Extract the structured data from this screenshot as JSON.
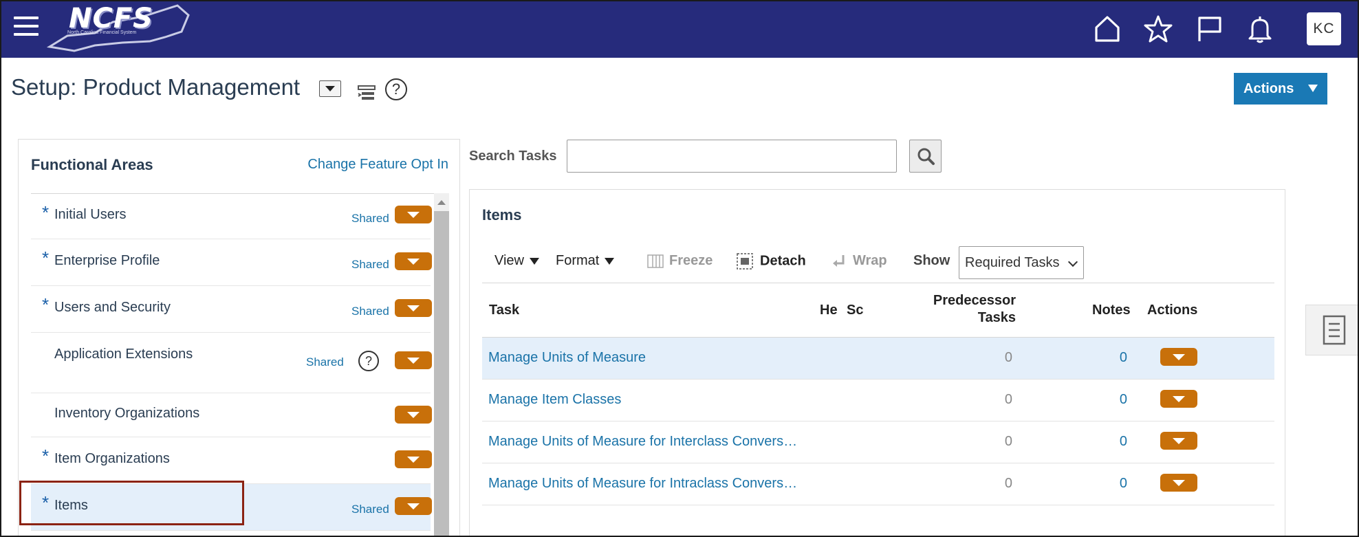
{
  "header": {
    "logo_text": "NCFS",
    "logo_subtitle": "North Carolina Financial System",
    "avatar_initials": "KC"
  },
  "page": {
    "title": "Setup: Product Management",
    "actions_label": "Actions"
  },
  "functional_areas": {
    "title": "Functional Areas",
    "change_link": "Change Feature Opt In",
    "items": [
      {
        "label": "Initial Users",
        "required": "*",
        "shared": "Shared"
      },
      {
        "label": "Enterprise Profile",
        "required": "*",
        "shared": "Shared"
      },
      {
        "label": "Users and Security",
        "required": "*",
        "shared": "Shared"
      },
      {
        "label": "Application Extensions",
        "required": "",
        "shared": "Shared"
      },
      {
        "label": "Inventory Organizations",
        "required": "",
        "shared": ""
      },
      {
        "label": "Item Organizations",
        "required": "*",
        "shared": ""
      },
      {
        "label": "Items",
        "required": "*",
        "shared": "Shared"
      }
    ],
    "help_glyph": "?"
  },
  "search": {
    "label": "Search Tasks",
    "value": "",
    "placeholder": ""
  },
  "items_panel": {
    "title": "Items",
    "toolbar": {
      "view": "View",
      "format": "Format",
      "freeze": "Freeze",
      "detach": "Detach",
      "wrap": "Wrap",
      "show_label": "Show",
      "show_value": "Required Tasks"
    },
    "columns": {
      "task": "Task",
      "he": "He",
      "sc": "Sc",
      "pred_line1": "Predecessor",
      "pred_line2": "Tasks",
      "notes": "Notes",
      "actions": "Actions"
    },
    "rows": [
      {
        "task": "Manage Units of Measure",
        "pred": "0",
        "notes": "0"
      },
      {
        "task": "Manage Item Classes",
        "pred": "0",
        "notes": "0"
      },
      {
        "task": "Manage Units of Measure for Interclass Convers…",
        "pred": "0",
        "notes": "0"
      },
      {
        "task": "Manage Units of Measure for Intraclass Convers…",
        "pred": "0",
        "notes": "0"
      }
    ]
  },
  "colors": {
    "header_bg": "#262b7c",
    "accent_blue": "#1a79b5",
    "link_blue": "#1a73a8",
    "action_orange": "#c8700a",
    "selection_bg": "#e4effa",
    "highlight_outline": "#8b2313"
  },
  "icons": [
    "hamburger-menu-icon",
    "home-icon",
    "star-icon",
    "flag-icon",
    "bell-icon",
    "task-flow-icon",
    "help-icon",
    "search-icon",
    "freeze-icon",
    "detach-icon",
    "wrap-icon",
    "drawer-tasks-icon"
  ]
}
